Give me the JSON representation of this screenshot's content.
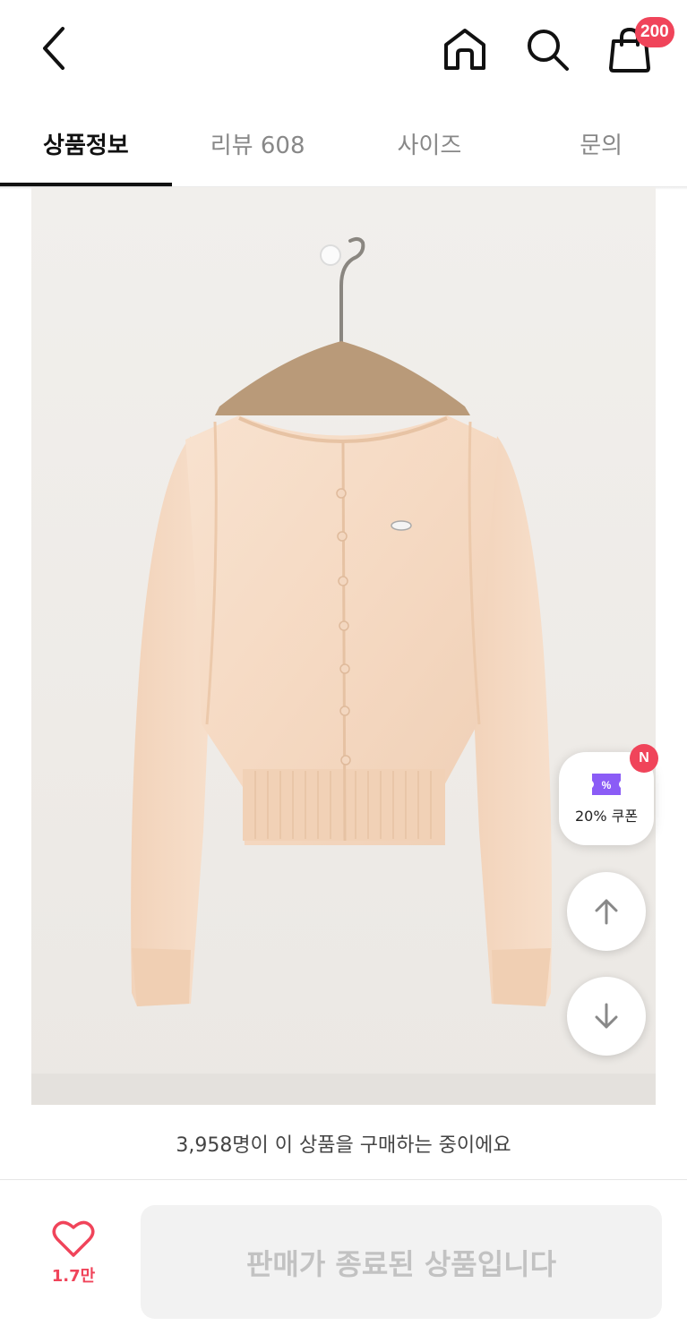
{
  "header": {
    "cart_badge": "200"
  },
  "tabs": [
    {
      "label": "상품정보",
      "active": true
    },
    {
      "label": "리뷰 608",
      "active": false
    },
    {
      "label": "사이즈",
      "active": false
    },
    {
      "label": "문의",
      "active": false
    }
  ],
  "floating": {
    "coupon_label": "20% 쿠폰",
    "new_badge": "N"
  },
  "buying_info": "3,958명이 이 상품을 구매하는 중이에요",
  "bottom": {
    "like_count": "1.7만",
    "sold_out_label": "판매가 종료된 상품입니다"
  },
  "colors": {
    "accent": "#f0445a",
    "coupon": "#8b5cf6",
    "product_bg": "#efedea",
    "garment": "#f6dcc6"
  },
  "icons": [
    "back-arrow-icon",
    "home-icon",
    "search-icon",
    "shopping-bag-icon",
    "coupon-ticket-icon",
    "arrow-up-icon",
    "arrow-down-icon",
    "heart-icon"
  ]
}
